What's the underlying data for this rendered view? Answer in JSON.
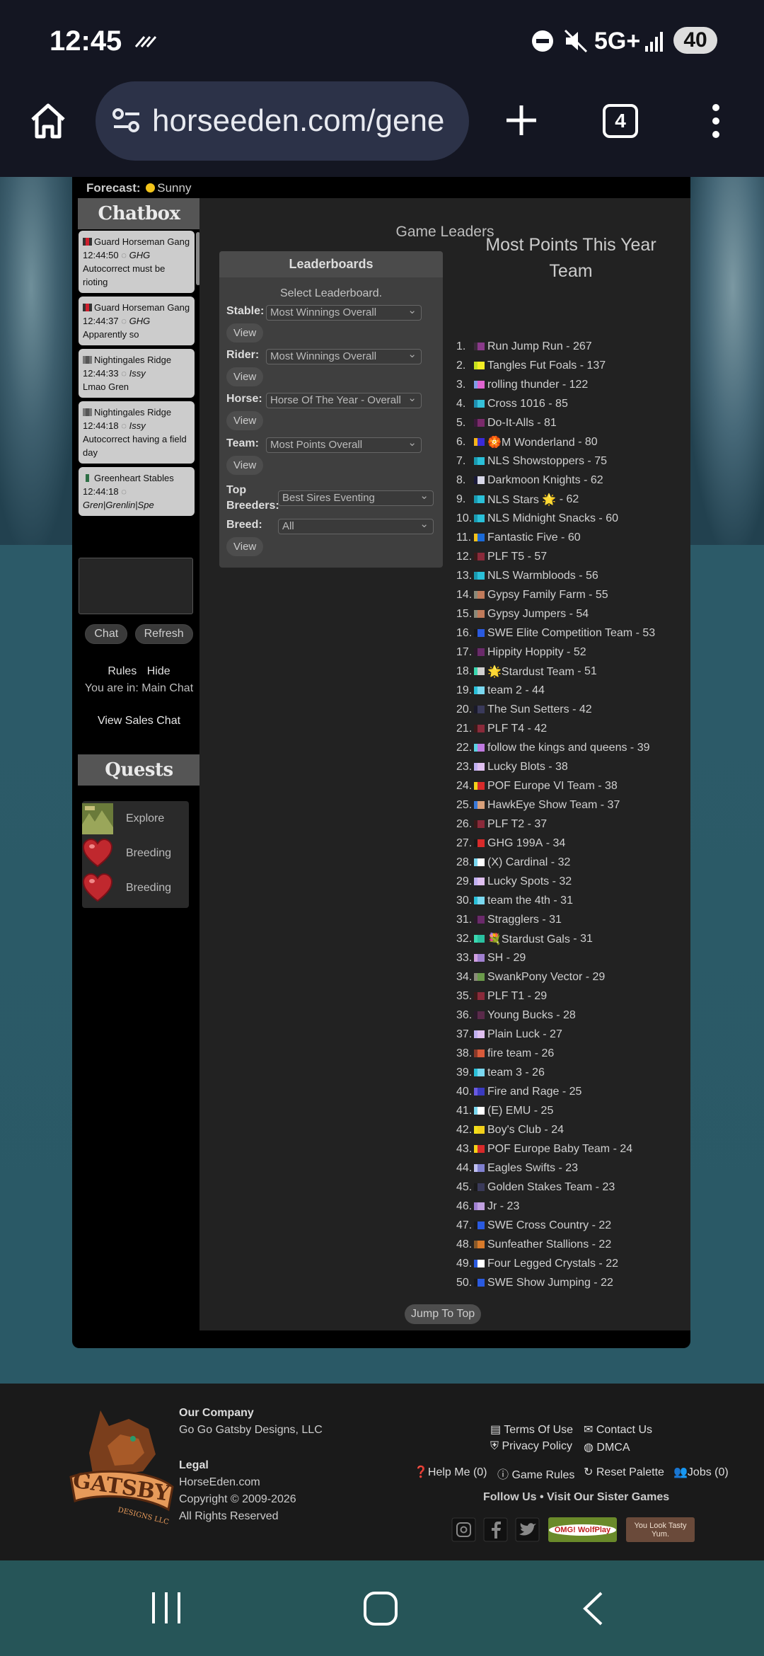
{
  "status": {
    "time": "12:45",
    "battery": "40",
    "network": "5G+"
  },
  "browser": {
    "url": "horseeden.com/gene",
    "tab_count": "4"
  },
  "forecast": {
    "label": "Forecast:",
    "value": "Sunny"
  },
  "chatbox": {
    "title": "Chatbox",
    "messages": [
      {
        "stable": "Guard Horseman Gang",
        "time": "12:44:50",
        "user": "GHG",
        "text": "Autocorrect must be rioting",
        "flag": [
          "#cf1f2d",
          "#333"
        ]
      },
      {
        "stable": "Guard Horseman Gang",
        "time": "12:44:37",
        "user": "GHG",
        "text": "Apparently so",
        "flag": [
          "#cf1f2d",
          "#333"
        ]
      },
      {
        "stable": "Nightingales Ridge",
        "time": "12:44:33",
        "user": "Issy",
        "text": "Lmao Gren",
        "flag": [
          "#555",
          "#777"
        ]
      },
      {
        "stable": "Nightingales Ridge",
        "time": "12:44:18",
        "user": "Issy",
        "text": "Autocorrect having a field day",
        "flag": [
          "#555",
          "#777"
        ]
      },
      {
        "stable": "Greenheart Stables",
        "time": "12:44:18",
        "user": "Gren|Grenlin|Spe",
        "text": "",
        "flag": [
          "#2d6f45",
          "#ccc"
        ]
      }
    ],
    "chat_button": "Chat",
    "refresh_button": "Refresh",
    "rules_link": "Rules",
    "hide_link": "Hide",
    "location": "You are in: Main Chat",
    "sales_chat_link": "View Sales Chat"
  },
  "quests": {
    "title": "Quests",
    "items": [
      {
        "label": "Explore",
        "icon": "explore-icon"
      },
      {
        "label": "Breeding",
        "icon": "heart-icon"
      },
      {
        "label": "Breeding",
        "icon": "heart-icon"
      }
    ]
  },
  "main": {
    "title": "Game Leaders"
  },
  "leaderboards": {
    "title": "Leaderboards",
    "select_label": "Select Leaderboard.",
    "view": "View",
    "rows": [
      {
        "label": "Stable:",
        "value": "Most Winnings Overall"
      },
      {
        "label": "Rider:",
        "value": "Most Winnings Overall"
      },
      {
        "label": "Horse:",
        "value": "Horse Of The Year - Overall"
      },
      {
        "label": "Team:",
        "value": "Most Points Overall"
      },
      {
        "label": "Top Breeders:",
        "value": "Best Sires Eventing"
      },
      {
        "label": "Breed:",
        "value": "All"
      }
    ]
  },
  "ranking": {
    "title_line1": "Most Points This Year",
    "title_line2": "Team",
    "items": [
      {
        "rank": "1.",
        "name": "Run Jump Run",
        "points": "267",
        "colors": [
          "#3a2a3a",
          "#8a3a8a"
        ]
      },
      {
        "rank": "2.",
        "name": "Tangles Fut Foals",
        "points": "137",
        "colors": [
          "#c6e11f",
          "#f4ee24"
        ]
      },
      {
        "rank": "3.",
        "name": "rolling thunder",
        "points": "122",
        "colors": [
          "#7f9ee6",
          "#e064d0"
        ]
      },
      {
        "rank": "4.",
        "name": "Cross 1016",
        "points": "85",
        "colors": [
          "#1f8fb0",
          "#35c1d9"
        ]
      },
      {
        "rank": "5.",
        "name": "Do-It-Alls",
        "points": "81",
        "colors": [
          "#3a1a3a",
          "#7a2a6a"
        ]
      },
      {
        "rank": "6.",
        "name": "🏵️M Wonderland",
        "points": "80",
        "colors": [
          "#f2b31a",
          "#3a2ad8"
        ]
      },
      {
        "rank": "7.",
        "name": "NLS Showstoppers",
        "points": "75",
        "colors": [
          "#1a9ab0",
          "#2ac0d8"
        ]
      },
      {
        "rank": "8.",
        "name": "Darkmoon Knights",
        "points": "62",
        "colors": [
          "#1a1a3a",
          "#d8d8e8"
        ]
      },
      {
        "rank": "9.",
        "name": "NLS Stars 🌟",
        "points": "62",
        "colors": [
          "#1a9ab0",
          "#2ac0d8"
        ]
      },
      {
        "rank": "10.",
        "name": "NLS Midnight Snacks",
        "points": "60",
        "colors": [
          "#1a9ab0",
          "#2ac0d8"
        ]
      },
      {
        "rank": "11.",
        "name": "Fantastic Five",
        "points": "60",
        "colors": [
          "#f2c01a",
          "#1a6ad8"
        ]
      },
      {
        "rank": "12.",
        "name": "PLF T5",
        "points": "57",
        "colors": [
          "#3a1a1a",
          "#8a2a3a"
        ]
      },
      {
        "rank": "13.",
        "name": "NLS Warmbloods",
        "points": "56",
        "colors": [
          "#1a9ab0",
          "#2ac0d8"
        ]
      },
      {
        "rank": "14.",
        "name": "Gypsy Family Farm",
        "points": "55",
        "colors": [
          "#8a8a7a",
          "#c07a5a"
        ]
      },
      {
        "rank": "15.",
        "name": "Gypsy Jumpers",
        "points": "54",
        "colors": [
          "#8a8a7a",
          "#c07a5a"
        ]
      },
      {
        "rank": "16.",
        "name": "SWE Elite Competition Team",
        "points": "53",
        "colors": [
          "#1a1a1a",
          "#2a5ae0"
        ]
      },
      {
        "rank": "17.",
        "name": "Hippity Hoppity",
        "points": "52",
        "colors": [
          "#2a1a2a",
          "#6a2a6a"
        ]
      },
      {
        "rank": "18.",
        "name": "🌟Stardust Team",
        "points": "51",
        "colors": [
          "#3ad8b0",
          "#d0d0d0"
        ]
      },
      {
        "rank": "19.",
        "name": "team 2",
        "points": "44",
        "colors": [
          "#2ac0d8",
          "#7ad8f0"
        ]
      },
      {
        "rank": "20.",
        "name": "The Sun Setters",
        "points": "42",
        "colors": [
          "#1a1a2a",
          "#3a3a5a"
        ]
      },
      {
        "rank": "21.",
        "name": "PLF T4",
        "points": "42",
        "colors": [
          "#3a1a1a",
          "#8a2a3a"
        ]
      },
      {
        "rank": "22.",
        "name": "follow the kings and queens",
        "points": "39",
        "colors": [
          "#5ad0e0",
          "#c07ae0"
        ]
      },
      {
        "rank": "23.",
        "name": "Lucky Blots",
        "points": "38",
        "colors": [
          "#c0b0f0",
          "#e0c0f0"
        ]
      },
      {
        "rank": "24.",
        "name": "POF Europe VI Team",
        "points": "38",
        "colors": [
          "#f2d01a",
          "#d82a2a"
        ]
      },
      {
        "rank": "25.",
        "name": "HawkEye Show Team",
        "points": "37",
        "colors": [
          "#3a7ad8",
          "#d8a07a"
        ]
      },
      {
        "rank": "26.",
        "name": "PLF T2",
        "points": "37",
        "colors": [
          "#3a1a1a",
          "#8a2a3a"
        ]
      },
      {
        "rank": "27.",
        "name": "GHG 199A",
        "points": "34",
        "colors": [
          "#1a1a1a",
          "#d82a2a"
        ]
      },
      {
        "rank": "28.",
        "name": "(X) Cardinal",
        "points": "32",
        "colors": [
          "#7ad8f0",
          "#ffffff"
        ]
      },
      {
        "rank": "29.",
        "name": "Lucky Spots",
        "points": "32",
        "colors": [
          "#c0b0f0",
          "#e0c0f0"
        ]
      },
      {
        "rank": "30.",
        "name": "team the 4th",
        "points": "31",
        "colors": [
          "#2ac0d8",
          "#7ad8f0"
        ]
      },
      {
        "rank": "31.",
        "name": "Stragglers",
        "points": "31",
        "colors": [
          "#2a1a2a",
          "#6a2a6a"
        ]
      },
      {
        "rank": "32.",
        "name": "💐Stardust Gals",
        "points": "31",
        "colors": [
          "#3ad8b0",
          "#2ac0a0"
        ]
      },
      {
        "rank": "33.",
        "name": "SH",
        "points": "29",
        "colors": [
          "#d0a0e0",
          "#a080d0"
        ]
      },
      {
        "rank": "34.",
        "name": "SwankPony Vector",
        "points": "29",
        "colors": [
          "#8a8a7a",
          "#6a9a4a"
        ]
      },
      {
        "rank": "35.",
        "name": "PLF T1",
        "points": "29",
        "colors": [
          "#3a1a1a",
          "#8a2a3a"
        ]
      },
      {
        "rank": "36.",
        "name": "Young Bucks",
        "points": "28",
        "colors": [
          "#2a1a2a",
          "#5a2a4a"
        ]
      },
      {
        "rank": "37.",
        "name": "Plain Luck",
        "points": "27",
        "colors": [
          "#c0b0f0",
          "#e0c0f0"
        ]
      },
      {
        "rank": "38.",
        "name": "fire team",
        "points": "26",
        "colors": [
          "#8a3a2a",
          "#d85a3a"
        ]
      },
      {
        "rank": "39.",
        "name": "team 3",
        "points": "26",
        "colors": [
          "#2ac0d8",
          "#7ad8f0"
        ]
      },
      {
        "rank": "40.",
        "name": "Fire and Rage",
        "points": "25",
        "colors": [
          "#6a5ae0",
          "#3a3ac0"
        ]
      },
      {
        "rank": "41.",
        "name": "(E) EMU",
        "points": "25",
        "colors": [
          "#7ad8f0",
          "#ffffff"
        ]
      },
      {
        "rank": "42.",
        "name": "Boy's Club",
        "points": "24",
        "colors": [
          "#f2e01a",
          "#f2d01a"
        ]
      },
      {
        "rank": "43.",
        "name": "POF Europe Baby Team",
        "points": "24",
        "colors": [
          "#f2d01a",
          "#d82a2a"
        ]
      },
      {
        "rank": "44.",
        "name": "Eagles Swifts",
        "points": "23",
        "colors": [
          "#c0c0f0",
          "#8080d0"
        ]
      },
      {
        "rank": "45.",
        "name": "Golden Stakes Team",
        "points": "23",
        "colors": [
          "#1a1a1a",
          "#3a3a5a"
        ]
      },
      {
        "rank": "46.",
        "name": "Jr",
        "points": "23",
        "colors": [
          "#a080d0",
          "#c0a0e0"
        ]
      },
      {
        "rank": "47.",
        "name": "SWE Cross Country",
        "points": "22",
        "colors": [
          "#1a1a1a",
          "#2a5ae0"
        ]
      },
      {
        "rank": "48.",
        "name": "Sunfeather Stallions",
        "points": "22",
        "colors": [
          "#8a5a2a",
          "#d87a2a"
        ]
      },
      {
        "rank": "49.",
        "name": "Four Legged Crystals",
        "points": "22",
        "colors": [
          "#2a5ae0",
          "#ffffff"
        ]
      },
      {
        "rank": "50.",
        "name": "SWE Show Jumping",
        "points": "22",
        "colors": [
          "#1a1a1a",
          "#2a5ae0"
        ]
      }
    ],
    "jump_top": "Jump To Top"
  },
  "footer": {
    "company_label": "Our Company",
    "company": "Go Go Gatsby Designs, LLC",
    "legal_label": "Legal",
    "site": "HorseEden.com",
    "copyright": "Copyright © 2009-2026",
    "rights": "All Rights Reserved",
    "terms": "Terms Of Use",
    "contact": "Contact Us",
    "privacy": "Privacy Policy",
    "dmca": "DMCA",
    "help": "Help Me (0)",
    "rules": "Game Rules",
    "palette": "Reset Palette",
    "jobs": "Jobs (0)",
    "follow": "Follow Us • Visit Our Sister Games",
    "logo_text": "GATSBY",
    "logo_sub": "DESIGNS LLC",
    "wolf_text": "OMG! WolfPlay",
    "tasty_text": "You Look Tasty Yum."
  }
}
